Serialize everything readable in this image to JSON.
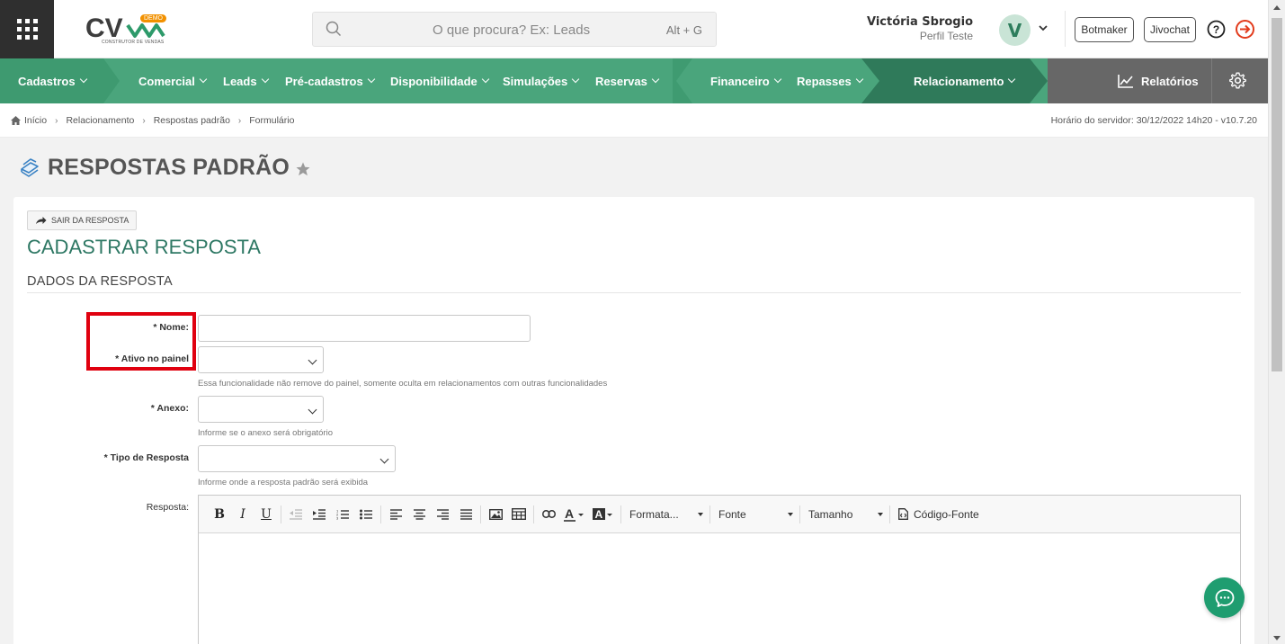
{
  "header": {
    "logo_text": "CV",
    "logo_tagline": "CONSTRUTOR DE VENDAS",
    "demo_badge": "DEMO",
    "search": {
      "placeholder": "O que procura? Ex: Leads",
      "shortcut": "Alt + G"
    },
    "user": {
      "name": "Victória Sbrogio",
      "role": "Perfil Teste",
      "avatar_letter": "V"
    },
    "buttons": {
      "botmaker": "Botmaker",
      "jivochat": "Jivochat"
    }
  },
  "nav": {
    "items": [
      {
        "label": "Cadastros"
      },
      {
        "label": "Comercial"
      },
      {
        "label": "Leads"
      },
      {
        "label": "Pré-cadastros"
      },
      {
        "label": "Disponibilidade"
      },
      {
        "label": "Simulações"
      },
      {
        "label": "Reservas"
      },
      {
        "label": "Financeiro"
      },
      {
        "label": "Repasses"
      },
      {
        "label": "Relacionamento"
      }
    ],
    "reports": "Relatórios"
  },
  "breadcrumb": {
    "items": [
      "Início",
      "Relacionamento",
      "Respostas padrão",
      "Formulário"
    ],
    "server_time": "Horário do servidor: 30/12/2022 14h20 - v10.7.20"
  },
  "page": {
    "title": "RESPOSTAS PADRÃO"
  },
  "form": {
    "back_button": "SAIR DA RESPOSTA",
    "title": "CADASTRAR RESPOSTA",
    "section": "DADOS DA RESPOSTA",
    "fields": {
      "nome": {
        "label": "* Nome:",
        "value": ""
      },
      "ativo": {
        "label": "* Ativo no painel",
        "value": "",
        "help": "Essa funcionalidade não remove do painel, somente oculta em relacionamentos com outras funcionalidades"
      },
      "anexo": {
        "label": "* Anexo:",
        "value": "",
        "help": "Informe se o anexo será obrigatório"
      },
      "tipo": {
        "label": "* Tipo de Resposta",
        "value": "",
        "help": "Informe onde a resposta padrão será exibida"
      },
      "resposta": {
        "label": "Resposta:"
      }
    },
    "editor": {
      "bold": "B",
      "italic": "I",
      "underline": "U",
      "format": "Formata...",
      "font": "Fonte",
      "size": "Tamanho",
      "source": "Código-Fonte"
    }
  },
  "colors": {
    "nav_green": "#4aa57c",
    "nav_dark_green": "#2f7a5a",
    "accent_title": "#2e7864",
    "highlight": "#e0000f"
  }
}
